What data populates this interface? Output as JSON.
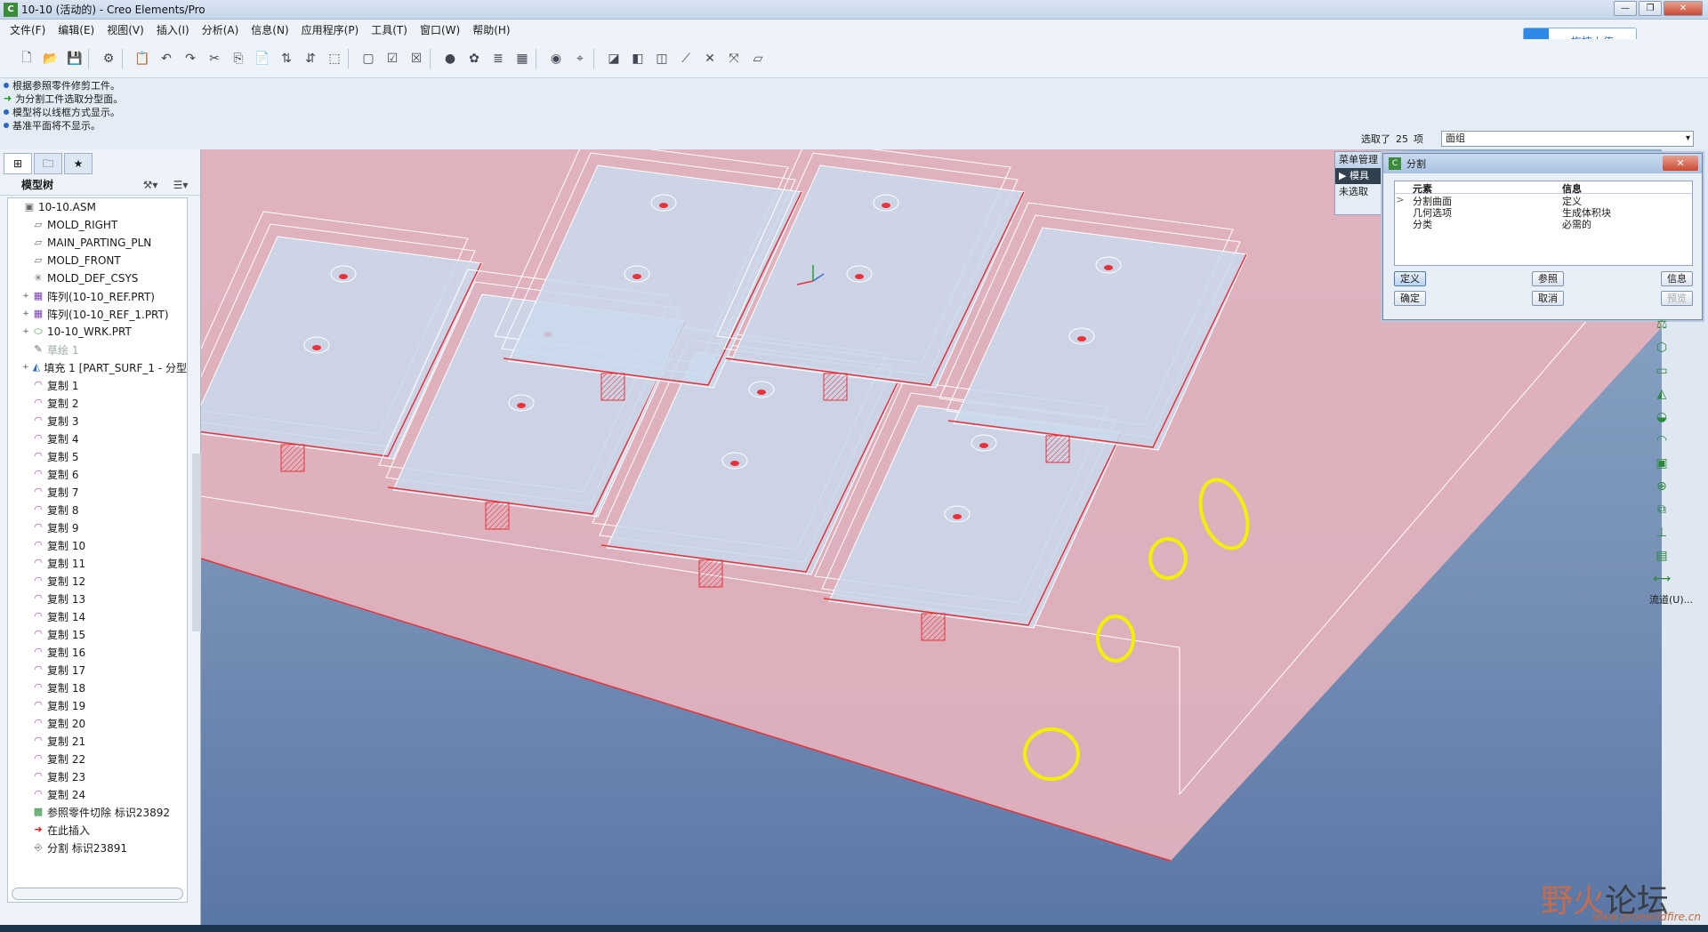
{
  "window": {
    "title": "10-10 (活动的) - Creo Elements/Pro",
    "app_icon": "creo-icon"
  },
  "menubar": [
    "文件(F)",
    "编辑(E)",
    "视图(V)",
    "插入(I)",
    "分析(A)",
    "信息(N)",
    "应用程序(P)",
    "工具(T)",
    "窗口(W)",
    "帮助(H)"
  ],
  "upload": {
    "label": "拖拽上传"
  },
  "messages": [
    {
      "type": "info",
      "text": "根据参照零件修剪工件。"
    },
    {
      "type": "prompt",
      "text": "为分割工件选取分型面。"
    },
    {
      "type": "info",
      "text": "模型将以线框方式显示。"
    },
    {
      "type": "info",
      "text": "基准平面将不显示。"
    }
  ],
  "selection": {
    "prefix": "选取了",
    "count": "25",
    "suffix": "项",
    "filter": "面组"
  },
  "model_tree": {
    "header": "模型树",
    "items": [
      {
        "label": "10-10.ASM",
        "icon": "assembly-icon",
        "indent": 0,
        "exp": ""
      },
      {
        "label": "MOLD_RIGHT",
        "icon": "datum-plane-icon",
        "indent": 1,
        "exp": ""
      },
      {
        "label": "MAIN_PARTING_PLN",
        "icon": "datum-plane-icon",
        "indent": 1,
        "exp": ""
      },
      {
        "label": "MOLD_FRONT",
        "icon": "datum-plane-icon",
        "indent": 1,
        "exp": ""
      },
      {
        "label": "MOLD_DEF_CSYS",
        "icon": "csys-icon",
        "indent": 1,
        "exp": ""
      },
      {
        "label": "阵列(10-10_REF.PRT)",
        "icon": "pattern-icon",
        "indent": 1,
        "exp": "+"
      },
      {
        "label": "阵列(10-10_REF_1.PRT)",
        "icon": "pattern-icon",
        "indent": 1,
        "exp": "+"
      },
      {
        "label": "10-10_WRK.PRT",
        "icon": "part-icon",
        "indent": 1,
        "exp": "+"
      },
      {
        "label": "草绘 1",
        "icon": "sketch-icon",
        "indent": 1,
        "exp": "",
        "grey": true
      },
      {
        "label": "填充 1 [PART_SURF_1 - 分型",
        "icon": "fill-surface-icon",
        "indent": 1,
        "exp": "+"
      },
      {
        "label": "复制 1",
        "icon": "copy-surface-icon",
        "indent": 1,
        "exp": ""
      },
      {
        "label": "复制 2",
        "icon": "copy-surface-icon",
        "indent": 1,
        "exp": ""
      },
      {
        "label": "复制 3",
        "icon": "copy-surface-icon",
        "indent": 1,
        "exp": ""
      },
      {
        "label": "复制 4",
        "icon": "copy-surface-icon",
        "indent": 1,
        "exp": ""
      },
      {
        "label": "复制 5",
        "icon": "copy-surface-icon",
        "indent": 1,
        "exp": ""
      },
      {
        "label": "复制 6",
        "icon": "copy-surface-icon",
        "indent": 1,
        "exp": ""
      },
      {
        "label": "复制 7",
        "icon": "copy-surface-icon",
        "indent": 1,
        "exp": ""
      },
      {
        "label": "复制 8",
        "icon": "copy-surface-icon",
        "indent": 1,
        "exp": ""
      },
      {
        "label": "复制 9",
        "icon": "copy-surface-icon",
        "indent": 1,
        "exp": ""
      },
      {
        "label": "复制 10",
        "icon": "copy-surface-icon",
        "indent": 1,
        "exp": ""
      },
      {
        "label": "复制 11",
        "icon": "copy-surface-icon",
        "indent": 1,
        "exp": ""
      },
      {
        "label": "复制 12",
        "icon": "copy-surface-icon",
        "indent": 1,
        "exp": ""
      },
      {
        "label": "复制 13",
        "icon": "copy-surface-icon",
        "indent": 1,
        "exp": ""
      },
      {
        "label": "复制 14",
        "icon": "copy-surface-icon",
        "indent": 1,
        "exp": ""
      },
      {
        "label": "复制 15",
        "icon": "copy-surface-icon",
        "indent": 1,
        "exp": ""
      },
      {
        "label": "复制 16",
        "icon": "copy-surface-icon",
        "indent": 1,
        "exp": ""
      },
      {
        "label": "复制 17",
        "icon": "copy-surface-icon",
        "indent": 1,
        "exp": ""
      },
      {
        "label": "复制 18",
        "icon": "copy-surface-icon",
        "indent": 1,
        "exp": ""
      },
      {
        "label": "复制 19",
        "icon": "copy-surface-icon",
        "indent": 1,
        "exp": ""
      },
      {
        "label": "复制 20",
        "icon": "copy-surface-icon",
        "indent": 1,
        "exp": ""
      },
      {
        "label": "复制 21",
        "icon": "copy-surface-icon",
        "indent": 1,
        "exp": ""
      },
      {
        "label": "复制 22",
        "icon": "copy-surface-icon",
        "indent": 1,
        "exp": ""
      },
      {
        "label": "复制 23",
        "icon": "copy-surface-icon",
        "indent": 1,
        "exp": ""
      },
      {
        "label": "复制 24",
        "icon": "copy-surface-icon",
        "indent": 1,
        "exp": ""
      },
      {
        "label": "参照零件切除 标识23892",
        "icon": "cut-icon",
        "indent": 1,
        "exp": ""
      },
      {
        "label": "在此插入",
        "icon": "insert-arrow-icon",
        "indent": 1,
        "exp": ""
      },
      {
        "label": "分割 标识23891",
        "icon": "split-icon",
        "indent": 1,
        "exp": ""
      }
    ]
  },
  "menu_manager": {
    "title": "菜单管理",
    "item1": "模具",
    "item2": "未选取"
  },
  "split_dialog": {
    "title": "分割",
    "columns": [
      "元素",
      "信息"
    ],
    "rows": [
      [
        "分割曲面",
        "定义"
      ],
      [
        "几何选项",
        "生成体积块"
      ],
      [
        "分类",
        "必需的"
      ]
    ],
    "buttons": {
      "define": "定义",
      "refs": "参照",
      "info": "信息",
      "ok": "确定",
      "cancel": "取消",
      "preview": "预览"
    }
  },
  "right_toolbar": {
    "label": "流道(U)..."
  },
  "watermark": {
    "main": "野火",
    "main2": "论坛",
    "sub": "www.proewildfire.cn"
  },
  "colors": {
    "surface": "#e6b3bd",
    "wire_red": "#e8323a",
    "highlight": "#f3f000",
    "viewport_top": "#8eaacb",
    "viewport_bottom": "#5a77a6"
  }
}
